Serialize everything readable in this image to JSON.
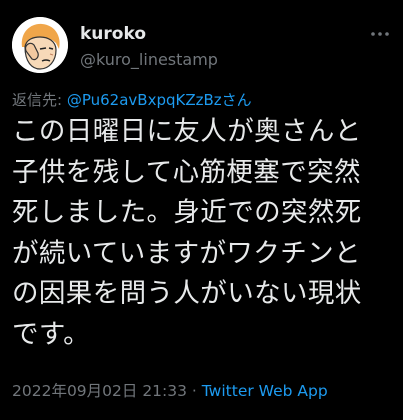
{
  "author": {
    "display_name": "kuroko",
    "handle": "@kuro_linestamp",
    "avatar_icon": "cartoon-face-avatar"
  },
  "more_icon": "more-options-icon",
  "reply": {
    "label": "返信先: ",
    "mention": "@Pu62avBxpqKZzBzさん"
  },
  "tweet": {
    "lines": [
      "この日曜日に友人が奥さんと",
      "子供を残して心筋梗塞で突然",
      "死しました。身近での突然死",
      "が続いていますがワクチンと",
      "の因果を問う人がいない現状",
      "です。"
    ]
  },
  "meta": {
    "timestamp": "2022年09月02日 21:33",
    "separator": " · ",
    "source": "Twitter Web App"
  },
  "colors": {
    "background": "#000000",
    "text": "#e7e9ea",
    "secondary": "#71767b",
    "accent": "#1d9bf0"
  }
}
